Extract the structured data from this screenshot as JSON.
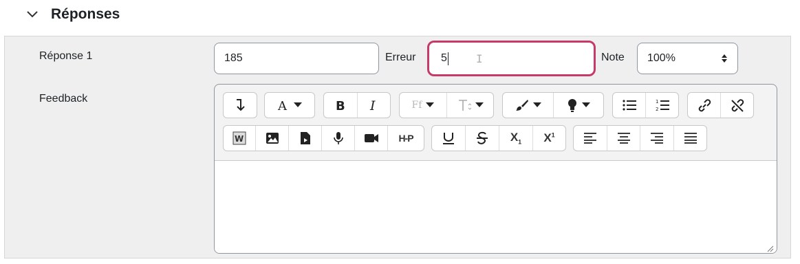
{
  "section": {
    "title": "Réponses",
    "icon": "chevron-down-icon"
  },
  "answer": {
    "label": "Réponse 1",
    "value": "185",
    "error_label": "Erreur",
    "error_value": "5",
    "note_label": "Note",
    "note_value": "100%"
  },
  "feedback": {
    "label": "Feedback",
    "toolbar_row1": [
      [
        "collapse-toolbar"
      ],
      [
        "font-color"
      ],
      [
        "bold",
        "italic"
      ],
      [
        "font-family",
        "font-size"
      ],
      [
        "background-color",
        "highlight"
      ],
      [
        "unordered-list",
        "ordered-list"
      ],
      [
        "link",
        "unlink"
      ]
    ],
    "toolbar_row2": [
      [
        "word-import",
        "image",
        "media-file",
        "record-audio",
        "record-video",
        "h5p"
      ],
      [
        "underline",
        "strikethrough",
        "subscript",
        "superscript"
      ],
      [
        "align-left",
        "align-center",
        "align-right",
        "align-justify"
      ]
    ],
    "h5p_text": "H-P",
    "ff_text": "Ff",
    "subscript_text": "X",
    "superscript_text": "X",
    "sub_digit": "1",
    "sup_digit": "1"
  },
  "colors": {
    "focus": "#c53a6a",
    "panel": "#efefef"
  }
}
